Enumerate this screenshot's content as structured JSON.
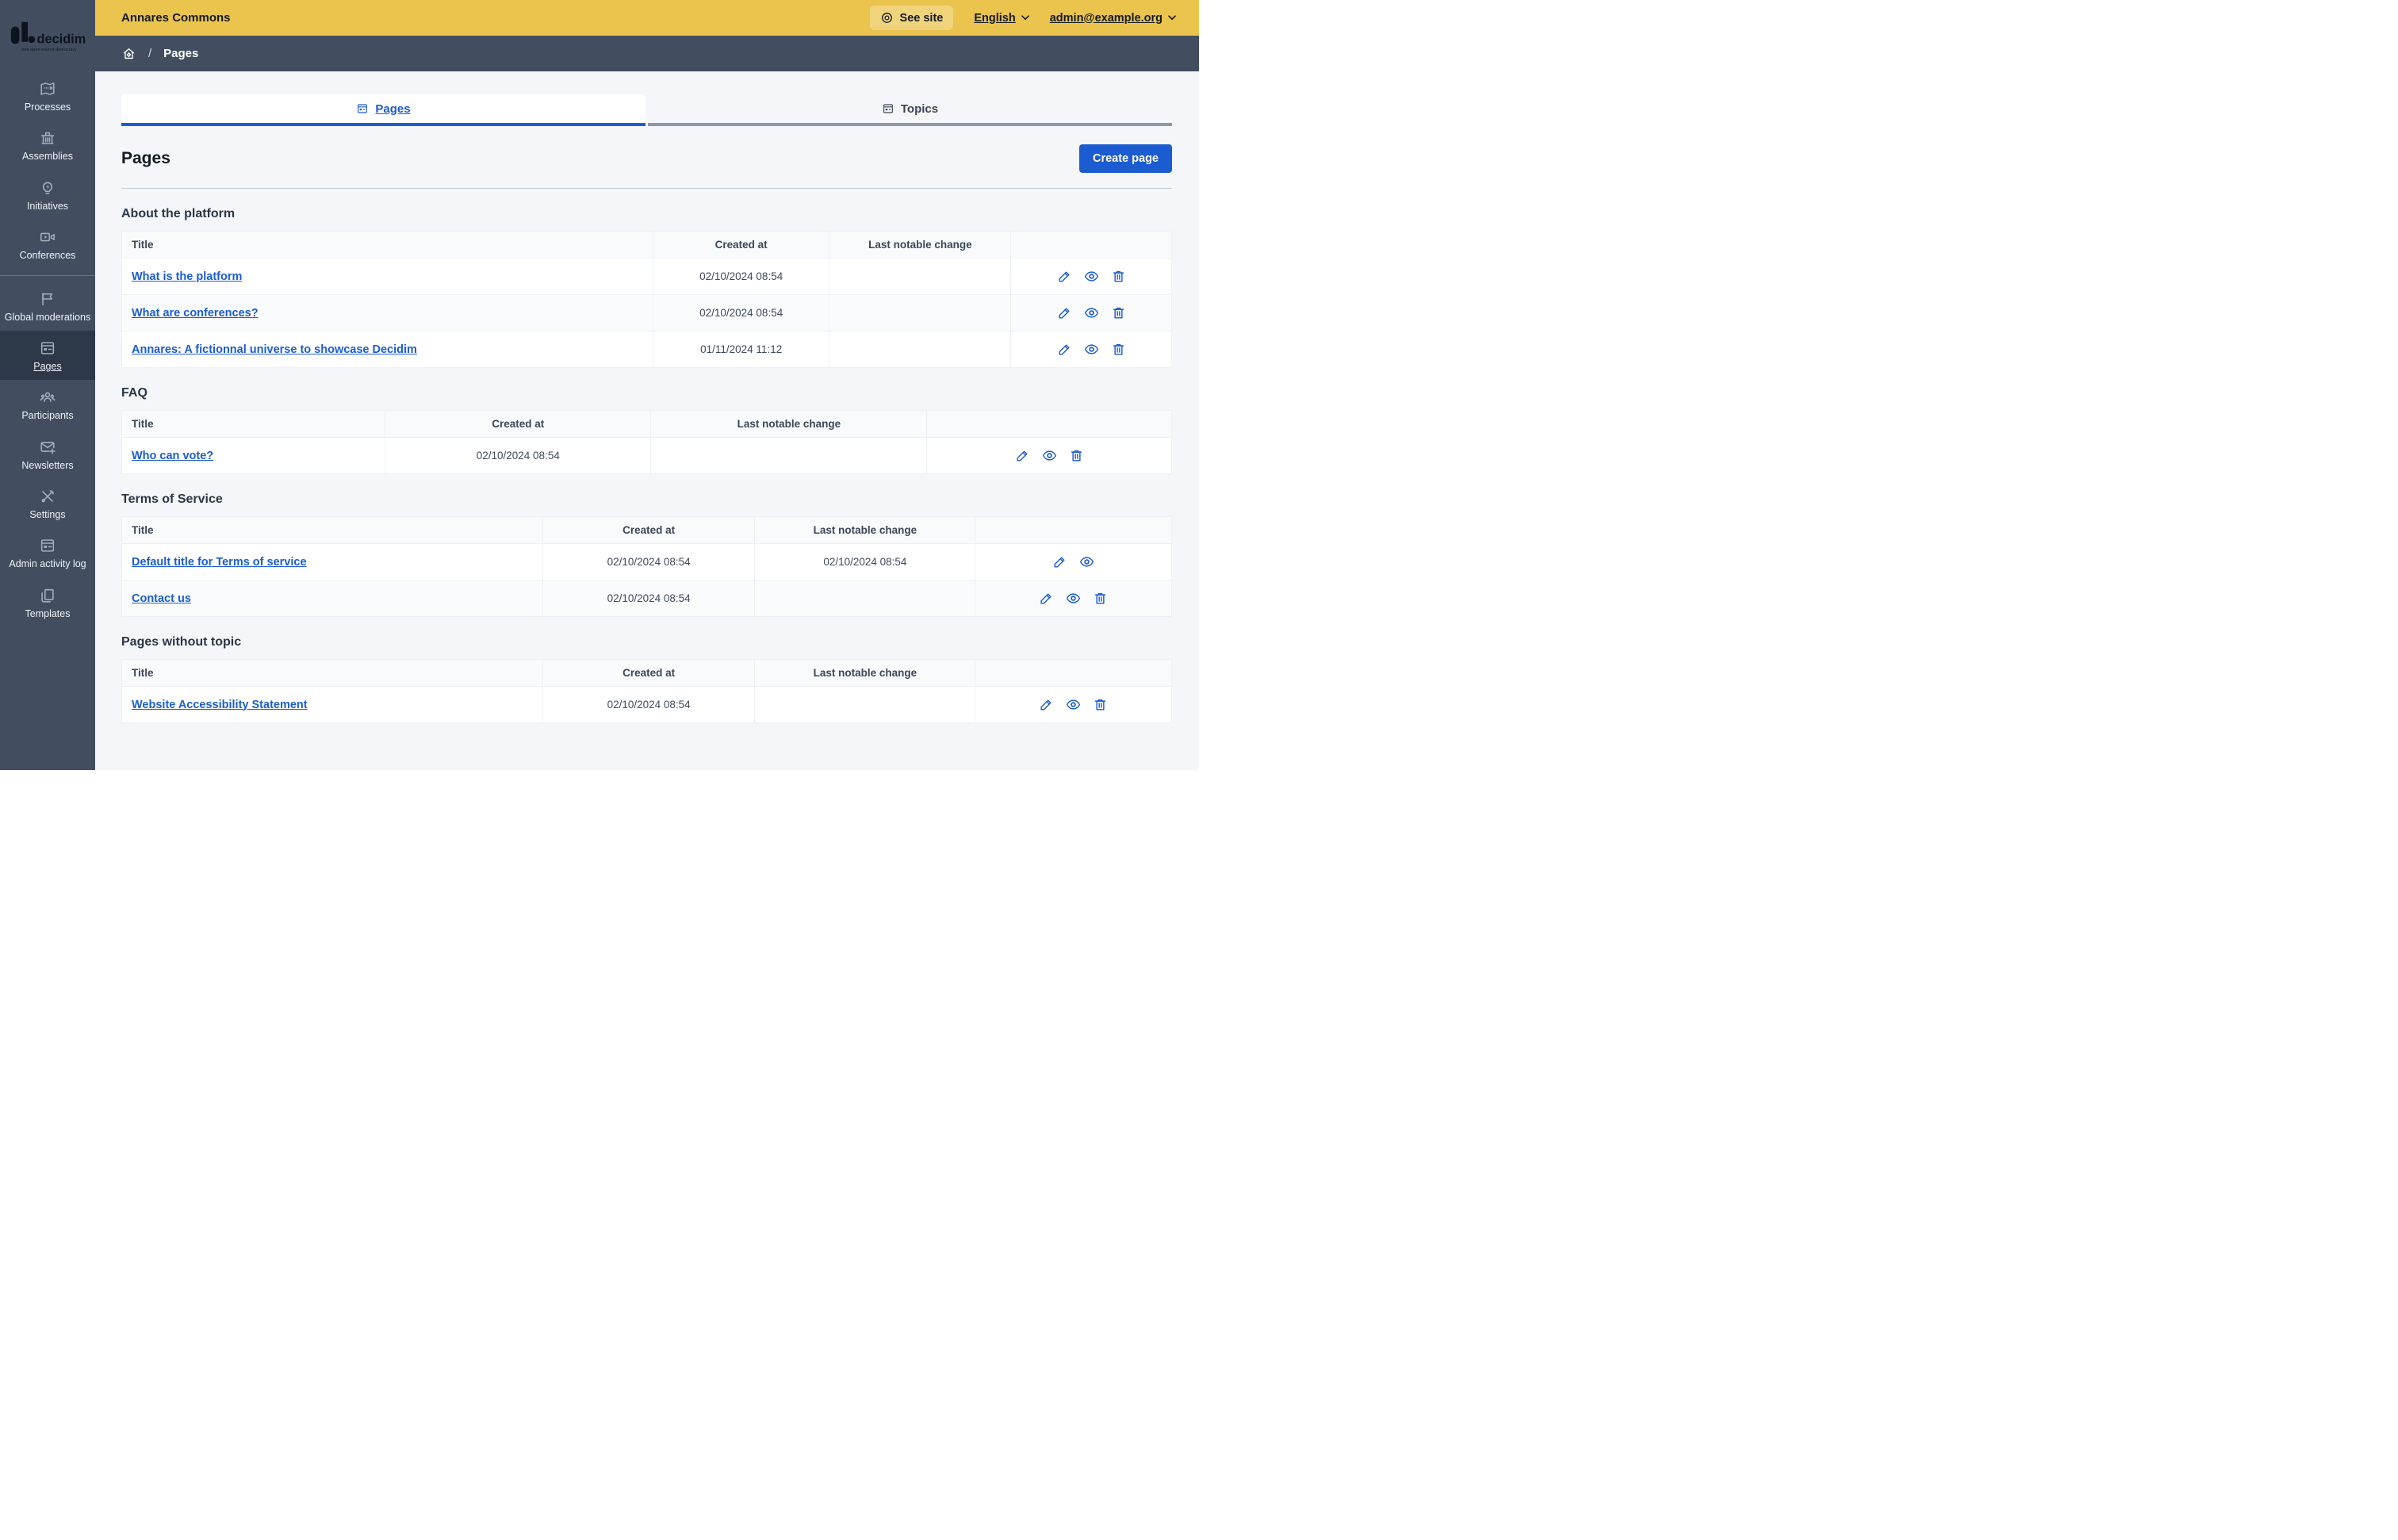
{
  "logo": {
    "name": "decidim",
    "tagline": "free open-source democracy"
  },
  "topbar": {
    "title": "Annares Commons",
    "see_site": "See site",
    "language": "English",
    "account": "admin@example.org"
  },
  "breadcrumb": {
    "current": "Pages"
  },
  "sidebar": {
    "groups": [
      [
        {
          "label": "Processes",
          "icon": "map-icon"
        },
        {
          "label": "Assemblies",
          "icon": "government-icon"
        },
        {
          "label": "Initiatives",
          "icon": "lightbulb-icon"
        },
        {
          "label": "Conferences",
          "icon": "video-icon"
        }
      ],
      [
        {
          "label": "Global moderations",
          "icon": "flag-icon"
        },
        {
          "label": "Pages",
          "icon": "article-icon",
          "active": true
        },
        {
          "label": "Participants",
          "icon": "team-icon"
        },
        {
          "label": "Newsletters",
          "icon": "mail-add-icon"
        },
        {
          "label": "Settings",
          "icon": "tools-icon"
        },
        {
          "label": "Admin activity log",
          "icon": "article-icon"
        },
        {
          "label": "Templates",
          "icon": "copy-icon"
        }
      ]
    ]
  },
  "tabs": [
    {
      "label": "Pages",
      "icon": "article-icon",
      "active": true
    },
    {
      "label": "Topics",
      "icon": "article-icon",
      "active": false
    }
  ],
  "page": {
    "title": "Pages",
    "create_button": "Create page"
  },
  "table": {
    "columns": [
      "Title",
      "Created at",
      "Last notable change",
      ""
    ]
  },
  "sections": [
    {
      "title": "About the platform",
      "col_widths": [
        "50.6%",
        "16.8%",
        "17.3%",
        "15.3%"
      ],
      "rows": [
        {
          "title": "What is the platform",
          "created_at": "02/10/2024 08:54",
          "last_change": "",
          "actions": [
            "edit",
            "preview",
            "delete"
          ]
        },
        {
          "title": "What are conferences?",
          "created_at": "02/10/2024 08:54",
          "last_change": "",
          "actions": [
            "edit",
            "preview",
            "delete"
          ]
        },
        {
          "title": "Annares: A fictionnal universe to showcase Decidim",
          "created_at": "01/11/2024 11:12",
          "last_change": "",
          "actions": [
            "edit",
            "preview",
            "delete"
          ]
        }
      ]
    },
    {
      "title": "FAQ",
      "col_widths": [
        "25.1%",
        "25.3%",
        "26.3%",
        "23.3%"
      ],
      "rows": [
        {
          "title": "Who can vote?",
          "created_at": "02/10/2024 08:54",
          "last_change": "",
          "actions": [
            "edit",
            "preview",
            "delete"
          ]
        }
      ]
    },
    {
      "title": "Terms of Service",
      "col_widths": [
        "40.1%",
        "20.2%",
        "21.0%",
        "18.7%"
      ],
      "rows": [
        {
          "title": "Default title for Terms of service",
          "created_at": "02/10/2024 08:54",
          "last_change": "02/10/2024 08:54",
          "actions": [
            "edit",
            "preview"
          ]
        },
        {
          "title": "Contact us",
          "created_at": "02/10/2024 08:54",
          "last_change": "",
          "actions": [
            "edit",
            "preview",
            "delete"
          ]
        }
      ]
    },
    {
      "title": "Pages without topic",
      "col_widths": [
        "40.1%",
        "20.2%",
        "21.0%",
        "18.7%"
      ],
      "rows": [
        {
          "title": "Website Accessibility Statement",
          "created_at": "02/10/2024 08:54",
          "last_change": "",
          "actions": [
            "edit",
            "preview",
            "delete"
          ]
        }
      ]
    }
  ],
  "colors": {
    "accent": "#1b5dd0",
    "topbar_bg": "#eac44d",
    "sidebar_bg": "#424e5f",
    "sidebar_active": "#2d3949",
    "main_bg": "#f4f6fa"
  }
}
